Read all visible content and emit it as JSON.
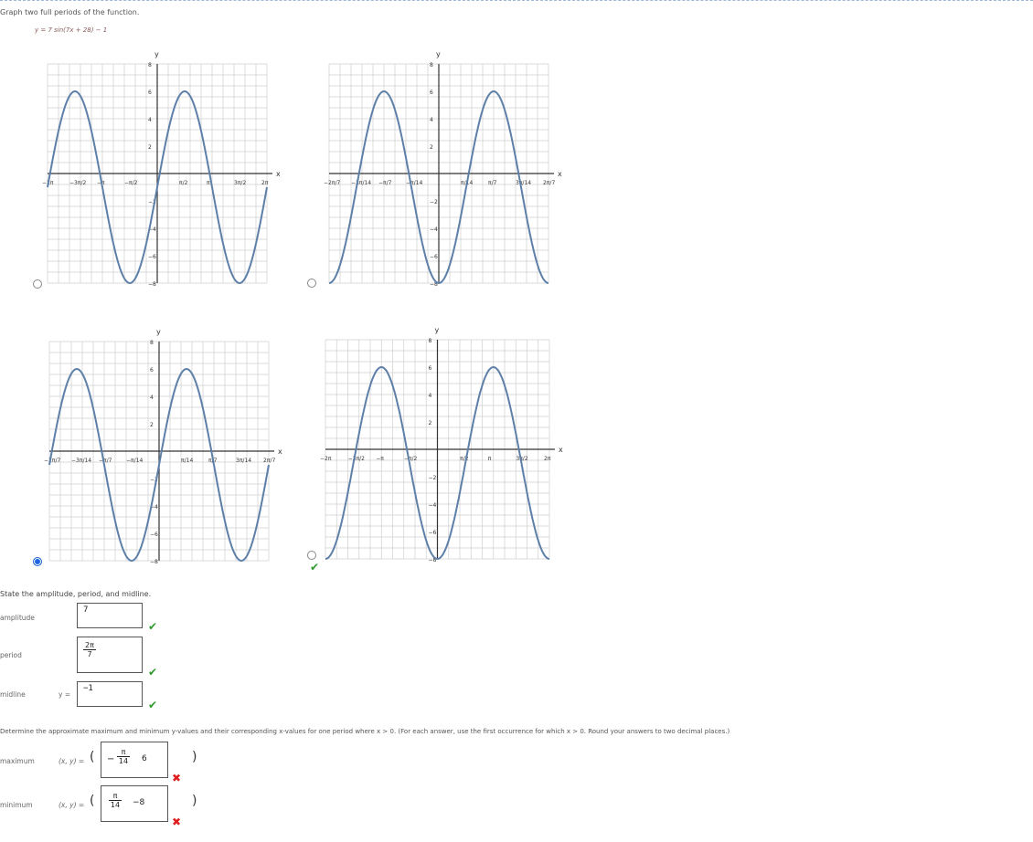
{
  "question": {
    "intro": "Graph two full periods of the function.",
    "function": "y = 7 sin(7x + 28) − 1"
  },
  "graphs": [
    {
      "id": "A",
      "selected": false,
      "x_tick_labels": [
        "−2π",
        "−3π/2",
        "−π",
        "−π/2",
        "π/2",
        "π",
        "3π/2",
        "2π"
      ],
      "y_tick_labels": [
        "8",
        "6",
        "4",
        "2",
        "−2",
        "−4",
        "−6",
        "−8"
      ],
      "axis_x": "x",
      "axis_y": "y"
    },
    {
      "id": "B",
      "selected": false,
      "x_tick_labels": [
        "−2π/7",
        "−3π/14",
        "−π/7",
        "−π/14",
        "π/14",
        "π/7",
        "3π/14",
        "2π/7"
      ],
      "y_tick_labels": [
        "8",
        "6",
        "4",
        "2",
        "−2",
        "−4",
        "−6",
        "−8"
      ],
      "axis_x": "x",
      "axis_y": "y"
    },
    {
      "id": "C",
      "selected": true,
      "x_tick_labels": [
        "−2π/7",
        "−3π/14",
        "−π/7",
        "−π/14",
        "π/14",
        "π/7",
        "3π/14",
        "2π/7"
      ],
      "y_tick_labels": [
        "8",
        "6",
        "4",
        "2",
        "−2",
        "−4",
        "−6",
        "−8"
      ],
      "axis_x": "x",
      "axis_y": "y"
    },
    {
      "id": "D",
      "selected": false,
      "x_tick_labels": [
        "−2π",
        "−3π/2",
        "−π",
        "−π/2",
        "π/2",
        "π",
        "3π/2",
        "2π"
      ],
      "y_tick_labels": [
        "8",
        "6",
        "4",
        "2",
        "−2",
        "−4",
        "−6",
        "−8"
      ],
      "axis_x": "x",
      "axis_y": "y"
    }
  ],
  "part2": {
    "title": "State the amplitude, period, and midline.",
    "amplitude_label": "amplitude",
    "amplitude_value": "7",
    "period_label": "period",
    "period_num": "2π",
    "period_den": "7",
    "midline_label": "midline",
    "midline_prefix": "y =",
    "midline_value": "−1"
  },
  "part3": {
    "instructions": "Determine the approximate maximum and minimum y-values and their corresponding x-values for one period where x > 0. (For each answer, use the first occurrence for which x > 0. Round your answers to two decimal places.)",
    "maximum_label": "maximum",
    "minimum_label": "minimum",
    "xy_label": "(x, y) =",
    "maximum_x_sign": "−",
    "maximum_x_num": "π",
    "maximum_x_den": "14",
    "maximum_y": "6",
    "minimum_x_num": "π",
    "minimum_x_den": "14",
    "minimum_y": "−8"
  },
  "marks": {
    "check": "✔",
    "cross": "✖"
  },
  "colors": {
    "curve": "#5d7fa8",
    "grid": "#cfcfcf",
    "axis": "#333333",
    "selected_radio": "#1e66e0",
    "correct": "#2e9a2e",
    "incorrect": "#e02020"
  }
}
